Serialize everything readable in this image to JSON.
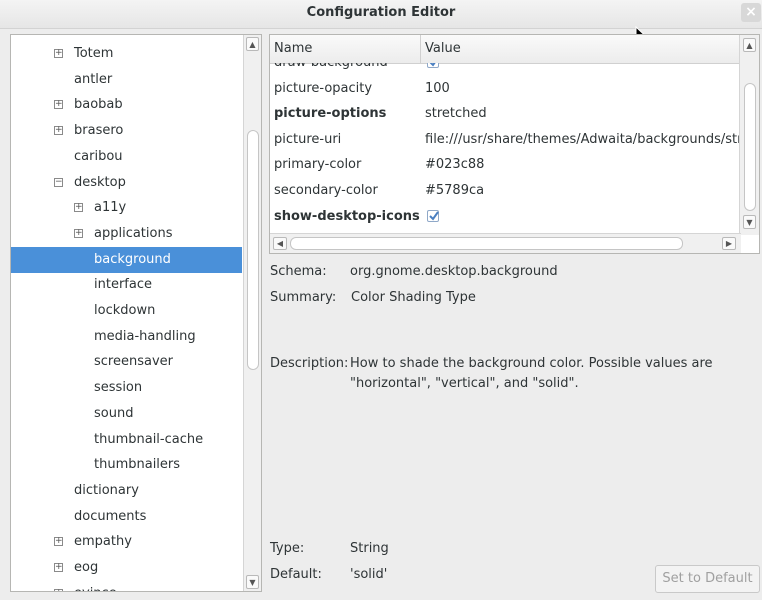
{
  "window": {
    "title": "Configuration Editor",
    "close_glyph": "×"
  },
  "tree": {
    "items": [
      {
        "label": "Totem",
        "expander": "collapsed",
        "level": 1
      },
      {
        "label": "antler",
        "expander": "none",
        "level": 1
      },
      {
        "label": "baobab",
        "expander": "collapsed",
        "level": 1
      },
      {
        "label": "brasero",
        "expander": "collapsed",
        "level": 1
      },
      {
        "label": "caribou",
        "expander": "none",
        "level": 1
      },
      {
        "label": "desktop",
        "expander": "expanded",
        "level": 1
      },
      {
        "label": "a11y",
        "expander": "collapsed",
        "level": 2
      },
      {
        "label": "applications",
        "expander": "collapsed",
        "level": 2
      },
      {
        "label": "background",
        "expander": "none",
        "level": 2,
        "selected": true
      },
      {
        "label": "interface",
        "expander": "none",
        "level": 2
      },
      {
        "label": "lockdown",
        "expander": "none",
        "level": 2
      },
      {
        "label": "media-handling",
        "expander": "none",
        "level": 2
      },
      {
        "label": "screensaver",
        "expander": "none",
        "level": 2
      },
      {
        "label": "session",
        "expander": "none",
        "level": 2
      },
      {
        "label": "sound",
        "expander": "none",
        "level": 2
      },
      {
        "label": "thumbnail-cache",
        "expander": "none",
        "level": 2
      },
      {
        "label": "thumbnailers",
        "expander": "none",
        "level": 2
      },
      {
        "label": "dictionary",
        "expander": "none",
        "level": 1
      },
      {
        "label": "documents",
        "expander": "none",
        "level": 1
      },
      {
        "label": "empathy",
        "expander": "collapsed",
        "level": 1
      },
      {
        "label": "eog",
        "expander": "collapsed",
        "level": 1
      },
      {
        "label": "evince",
        "expander": "collapsed",
        "level": 1
      }
    ]
  },
  "table": {
    "headers": {
      "name": "Name",
      "value": "Value"
    },
    "rows": [
      {
        "name": "draw-background",
        "value": "",
        "type": "checkbox",
        "checked": true,
        "bold": false
      },
      {
        "name": "picture-opacity",
        "value": "100",
        "type": "text",
        "bold": false
      },
      {
        "name": "picture-options",
        "value": "stretched",
        "type": "text",
        "bold": true
      },
      {
        "name": "picture-uri",
        "value": "file:///usr/share/themes/Adwaita/backgrounds/stripes.jpg",
        "type": "text",
        "bold": false
      },
      {
        "name": "primary-color",
        "value": "#023c88",
        "type": "text",
        "bold": false
      },
      {
        "name": "secondary-color",
        "value": "#5789ca",
        "type": "text",
        "bold": false
      },
      {
        "name": "show-desktop-icons",
        "value": "",
        "type": "checkbox",
        "checked": true,
        "bold": true
      }
    ]
  },
  "details": {
    "schema_label": "Schema:",
    "schema_value": "org.gnome.desktop.background",
    "summary_label": "Summary:",
    "summary_value": "Color Shading Type",
    "description_label": "Description:",
    "description_line1": "How to shade the background color. Possible values are",
    "description_line2": "\"horizontal\", \"vertical\", and \"solid\".",
    "type_label": "Type:",
    "type_value": "String",
    "default_label": "Default:",
    "default_value": "'solid'"
  },
  "buttons": {
    "set_to_default": "Set to Default"
  },
  "colors": {
    "selection": "#4a90d9",
    "check": "#4a7fc1"
  }
}
